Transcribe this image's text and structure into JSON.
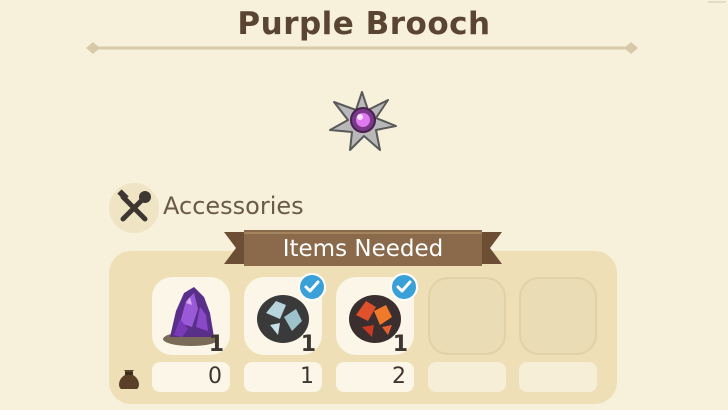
{
  "item": {
    "name": "Purple Brooch",
    "icon": "brooch-icon"
  },
  "category": {
    "label": "Accessories",
    "icon": "tools-icon"
  },
  "requirements": {
    "header": "Items Needed",
    "slots": [
      {
        "icon": "amethyst-icon",
        "required": "1",
        "owned": "0",
        "checked": false
      },
      {
        "icon": "silver-ore-icon",
        "required": "1",
        "owned": "1",
        "checked": true
      },
      {
        "icon": "fire-ore-icon",
        "required": "1",
        "owned": "2",
        "checked": true
      },
      {
        "icon": "empty-slot",
        "required": "",
        "owned": "",
        "checked": false
      },
      {
        "icon": "empty-slot",
        "required": "",
        "owned": "",
        "checked": false
      }
    ],
    "owned_icon": "bag-icon"
  },
  "colors": {
    "title": "#5a4432",
    "ribbon": "#8a6a4a",
    "check": "#3aa0d8",
    "background": "#f7f0da"
  }
}
